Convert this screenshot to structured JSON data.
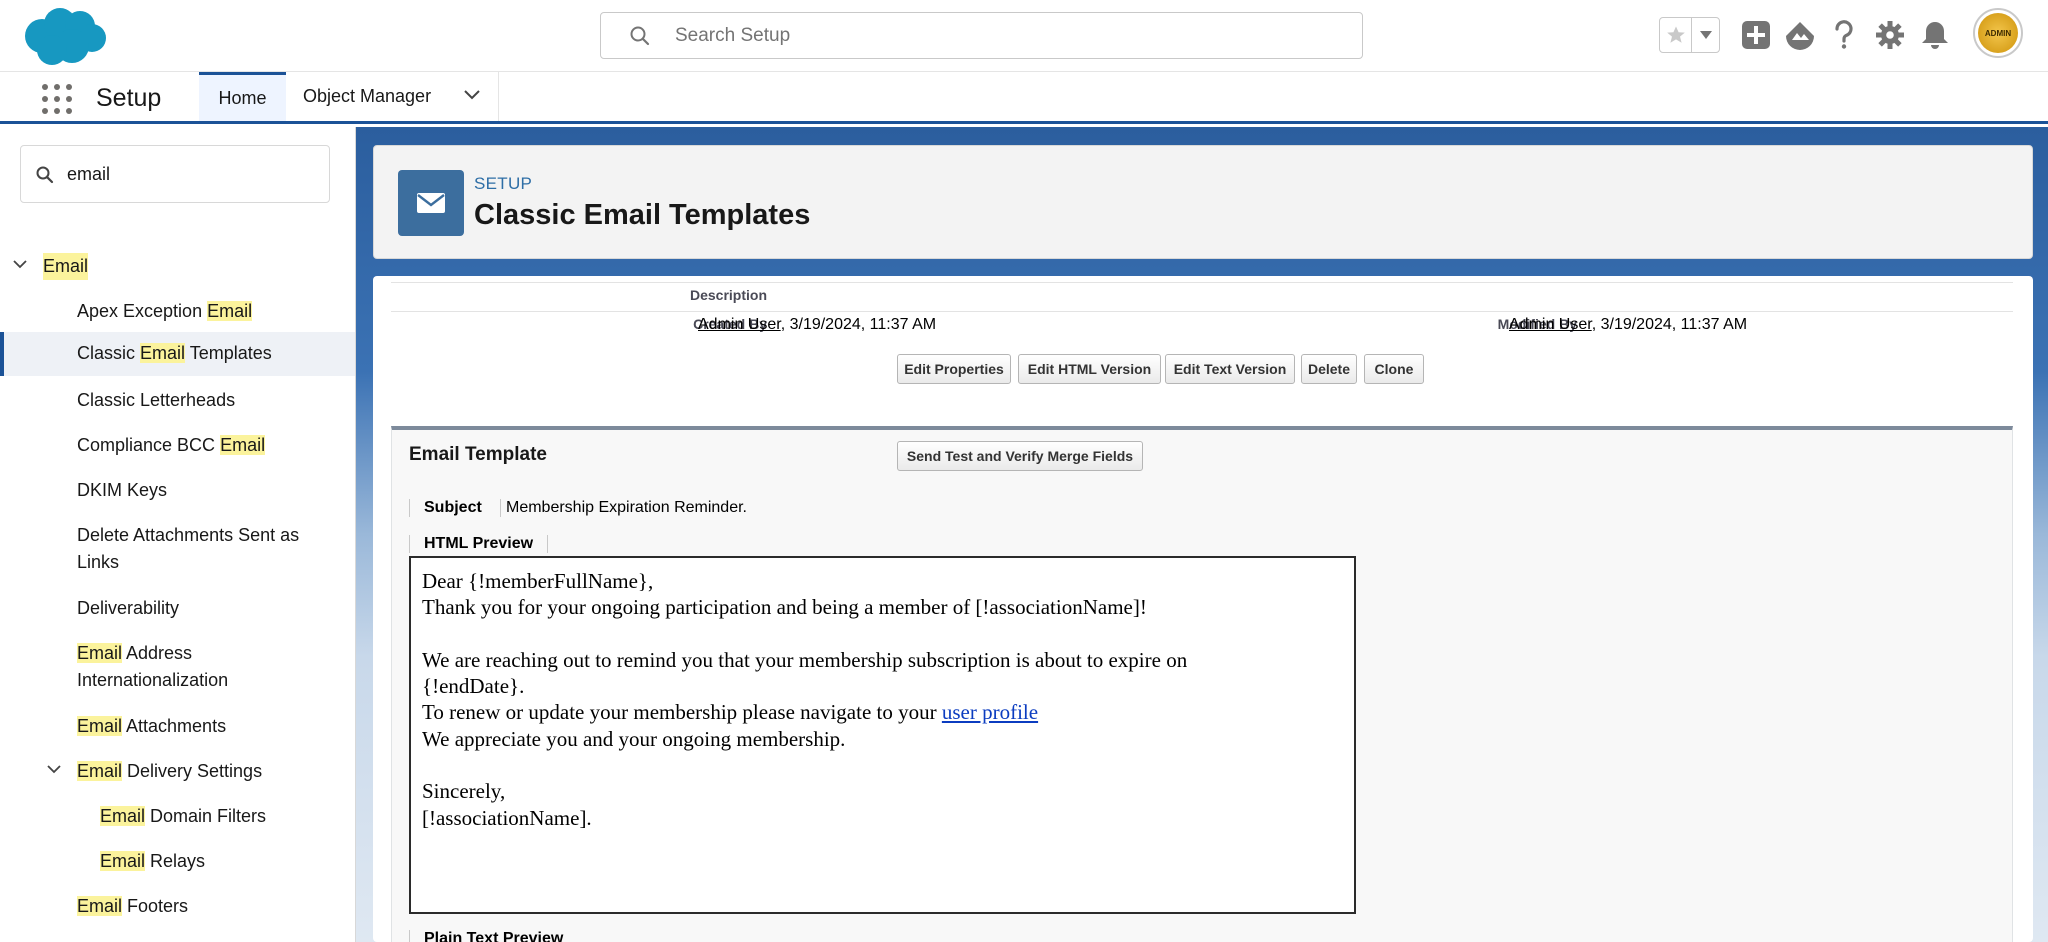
{
  "header": {
    "search_placeholder": "Search Setup",
    "avatar_text": "ADMIN",
    "brand_color": "#1798c1"
  },
  "context_nav": {
    "app_name": "Setup",
    "tabs": [
      {
        "label": "Home",
        "active": true
      },
      {
        "label": "Object Manager",
        "active": false
      }
    ]
  },
  "sidebar": {
    "quickfind_value": "email",
    "items": [
      {
        "pre": "",
        "hl": "Email",
        "post": "",
        "expanded": true
      },
      {
        "pre": "Apex Exception ",
        "hl": "Email",
        "post": ""
      },
      {
        "pre": "Classic ",
        "hl": "Email",
        "post": " Templates",
        "selected": true
      },
      {
        "pre": "Classic Letterheads",
        "hl": "",
        "post": ""
      },
      {
        "pre": "Compliance BCC ",
        "hl": "Email",
        "post": ""
      },
      {
        "pre": "DKIM Keys",
        "hl": "",
        "post": ""
      },
      {
        "line1": "Delete Attachments Sent as",
        "line2": "Links"
      },
      {
        "pre": "Deliverability",
        "hl": "",
        "post": ""
      },
      {
        "hl": "Email",
        "line1_post": " Address",
        "line2": "Internationalization"
      },
      {
        "pre": "",
        "hl": "Email",
        "post": " Attachments"
      },
      {
        "pre": "",
        "hl": "Email",
        "post": " Delivery Settings",
        "expanded": true
      },
      {
        "pre": "",
        "hl": "Email",
        "post": " Domain Filters"
      },
      {
        "pre": "",
        "hl": "Email",
        "post": " Relays"
      },
      {
        "pre": "",
        "hl": "Email",
        "post": " Footers"
      }
    ]
  },
  "page_header": {
    "eyebrow": "SETUP",
    "title": "Classic Email Templates"
  },
  "details": {
    "description_label": "Description",
    "created_by_label": "Created By",
    "created_by_user": "Admin User",
    "created_by_date": ", 3/19/2024, 11:37 AM",
    "modified_by_label": "Modified By",
    "modified_by_user": "Admin User",
    "modified_by_date": ", 3/19/2024, 11:37 AM"
  },
  "buttons": {
    "edit_properties": "Edit Properties",
    "edit_html": "Edit HTML Version",
    "edit_text": "Edit Text Version",
    "delete": "Delete",
    "clone": "Clone",
    "send_test": "Send Test and Verify Merge Fields"
  },
  "email_template": {
    "section_title": "Email Template",
    "subject_label": "Subject",
    "subject_value": "Membership Expiration Reminder.",
    "html_preview_label": "HTML Preview",
    "plain_text_label": "Plain Text Preview",
    "body": {
      "line1": "Dear {!memberFullName},",
      "line2": "Thank you for your ongoing participation and being a member of [!associationName]!",
      "line3": "We are reaching out to remind you that your membership subscription is about to expire on",
      "line4": "{!endDate}.",
      "line5_pre": "To renew or update your membership please navigate to your ",
      "line5_link": "user profile",
      "line6": "We appreciate you and your ongoing membership.",
      "line7": "Sincerely,",
      "line8": "[!associationName]."
    }
  }
}
